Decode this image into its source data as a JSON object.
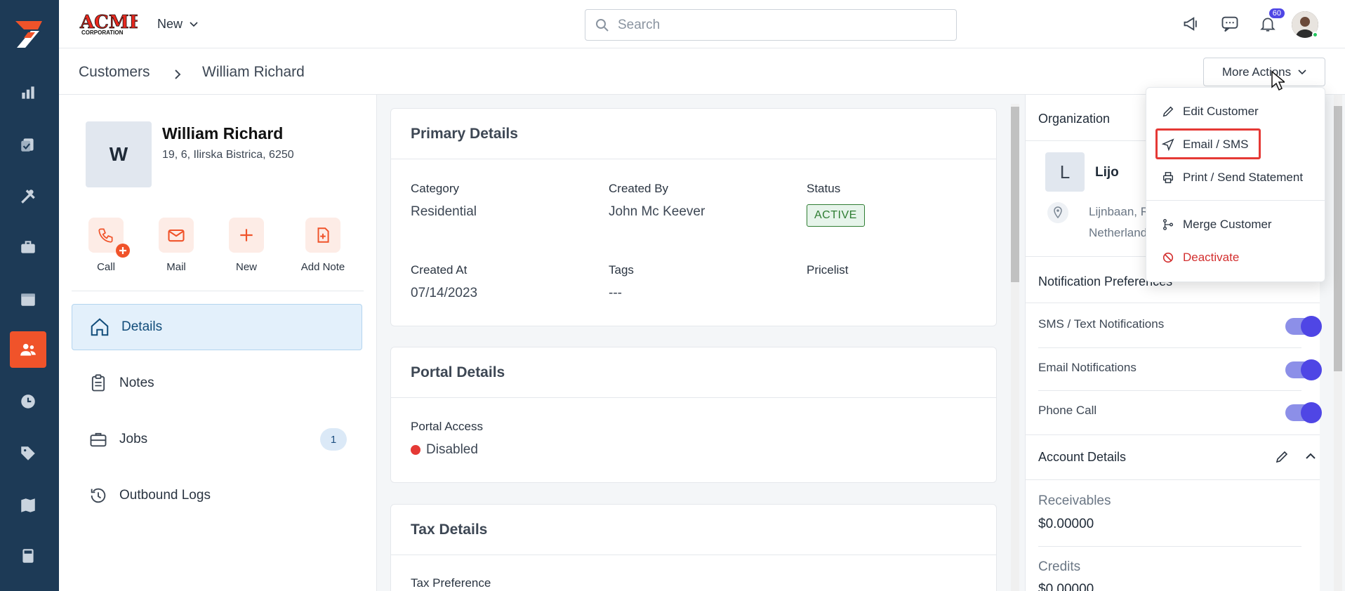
{
  "topbar": {
    "new_label": "New",
    "search_placeholder": "Search",
    "notification_count": "60"
  },
  "breadcrumb": {
    "root": "Customers",
    "current": "William Richard"
  },
  "more_actions_label": "More Actions",
  "customer": {
    "initial": "W",
    "name": "William Richard",
    "address": "19, 6, Ilirska Bistrica, 6250"
  },
  "quick_actions": [
    "Call",
    "Mail",
    "New",
    "Add Note"
  ],
  "menu": {
    "details": "Details",
    "notes": "Notes",
    "jobs": "Jobs",
    "jobs_count": "1",
    "outbound": "Outbound Logs"
  },
  "primary": {
    "title": "Primary Details",
    "category_label": "Category",
    "category": "Residential",
    "created_by_label": "Created By",
    "created_by": "John Mc Keever",
    "status_label": "Status",
    "status": "ACTIVE",
    "created_at_label": "Created At",
    "created_at": "07/14/2023",
    "tags_label": "Tags",
    "tags": "---",
    "pricelist_label": "Pricelist"
  },
  "portal": {
    "title": "Portal Details",
    "access_label": "Portal Access",
    "access": "Disabled"
  },
  "tax": {
    "title": "Tax Details",
    "pref_label": "Tax Preference"
  },
  "organization": {
    "title": "Organization",
    "initial": "L",
    "name": "Lijo",
    "addr1": "Lijnbaan, R",
    "addr2": "Netherland"
  },
  "notifications": {
    "title": "Notification Preferences",
    "sms": "SMS / Text Notifications",
    "email": "Email Notifications",
    "phone": "Phone Call"
  },
  "account": {
    "title": "Account Details",
    "receivables_label": "Receivables",
    "receivables": "$0.00000",
    "credits_label": "Credits",
    "credits": "$0.00000"
  },
  "dropdown": {
    "edit": "Edit Customer",
    "email": "Email / SMS",
    "print": "Print / Send Statement",
    "merge": "Merge Customer",
    "deactivate": "Deactivate"
  },
  "colors": {
    "nav_bg": "#1d3a56",
    "accent": "#f0532a",
    "toggle": "#4f46e5"
  }
}
